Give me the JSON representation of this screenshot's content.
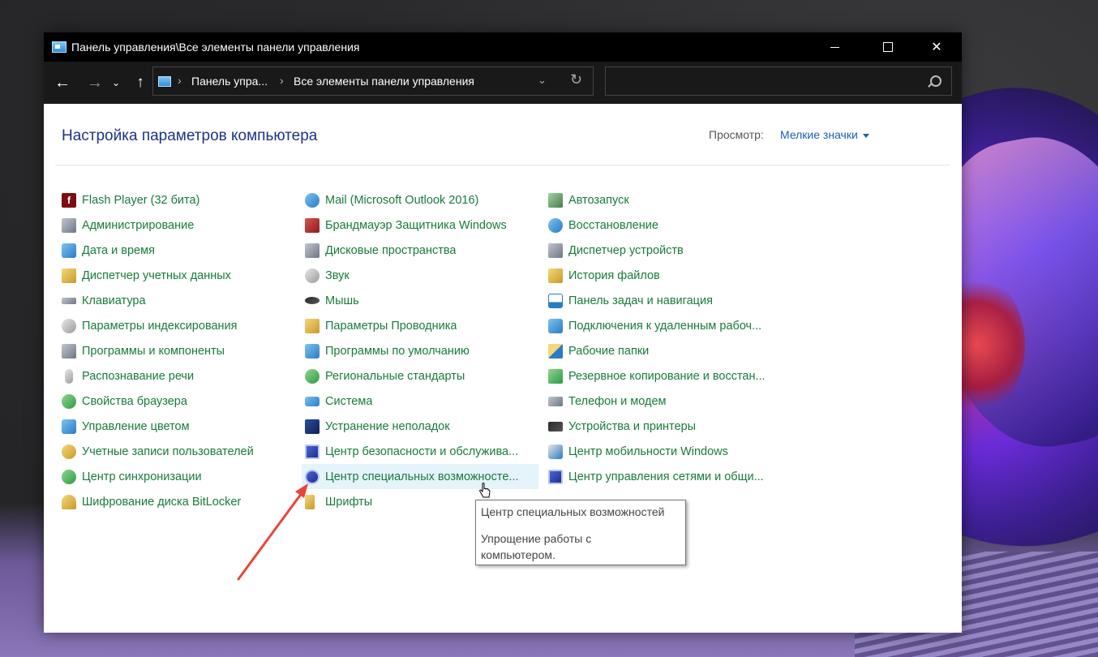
{
  "window": {
    "title": "Панель управления\\Все элементы панели управления",
    "controls": {
      "minimize": "minimize",
      "maximize": "maximize",
      "close": "close"
    }
  },
  "navigation": {
    "breadcrumbs": [
      "Панель упра...",
      "Все элементы панели управления"
    ],
    "search_placeholder": ""
  },
  "header": {
    "title": "Настройка параметров компьютера",
    "view_label": "Просмотр:",
    "view_value": "Мелкие значки"
  },
  "columns": [
    [
      {
        "label": "Flash Player (32 бита)",
        "icon": "flash-icon"
      },
      {
        "label": "Администрирование",
        "icon": "admin-tools-icon"
      },
      {
        "label": "Дата и время",
        "icon": "calendar-clock-icon"
      },
      {
        "label": "Диспетчер учетных данных",
        "icon": "credential-vault-icon"
      },
      {
        "label": "Клавиатура",
        "icon": "keyboard-icon"
      },
      {
        "label": "Параметры индексирования",
        "icon": "indexing-icon"
      },
      {
        "label": "Программы и компоненты",
        "icon": "programs-icon"
      },
      {
        "label": "Распознавание речи",
        "icon": "microphone-icon"
      },
      {
        "label": "Свойства браузера",
        "icon": "globe-icon"
      },
      {
        "label": "Управление цветом",
        "icon": "color-management-icon"
      },
      {
        "label": "Учетные записи пользователей",
        "icon": "users-icon"
      },
      {
        "label": "Центр синхронизации",
        "icon": "sync-icon"
      },
      {
        "label": "Шифрование диска BitLocker",
        "icon": "key-icon"
      }
    ],
    [
      {
        "label": "Mail (Microsoft Outlook 2016)",
        "icon": "mail-icon"
      },
      {
        "label": "Брандмауэр Защитника Windows",
        "icon": "firewall-icon"
      },
      {
        "label": "Дисковые пространства",
        "icon": "storage-spaces-icon"
      },
      {
        "label": "Звук",
        "icon": "speaker-icon"
      },
      {
        "label": "Мышь",
        "icon": "mouse-icon"
      },
      {
        "label": "Параметры Проводника",
        "icon": "folder-options-icon"
      },
      {
        "label": "Программы по умолчанию",
        "icon": "default-programs-icon"
      },
      {
        "label": "Региональные стандарты",
        "icon": "region-icon"
      },
      {
        "label": "Система",
        "icon": "system-icon"
      },
      {
        "label": "Устранение неполадок",
        "icon": "troubleshoot-icon"
      },
      {
        "label": "Центр безопасности и обслужива...",
        "icon": "flag-icon"
      },
      {
        "label": "Центр специальных возможносте...",
        "icon": "accessibility-icon"
      },
      {
        "label": "Шрифты",
        "icon": "fonts-icon"
      }
    ],
    [
      {
        "label": "Автозапуск",
        "icon": "autoplay-icon"
      },
      {
        "label": "Восстановление",
        "icon": "recovery-icon"
      },
      {
        "label": "Диспетчер устройств",
        "icon": "device-manager-icon"
      },
      {
        "label": "История файлов",
        "icon": "file-history-icon"
      },
      {
        "label": "Панель задач и навигация",
        "icon": "taskbar-icon"
      },
      {
        "label": "Подключения к удаленным рабоч...",
        "icon": "remote-desktop-icon"
      },
      {
        "label": "Рабочие папки",
        "icon": "work-folders-icon"
      },
      {
        "label": "Резервное копирование и восстан...",
        "icon": "backup-icon"
      },
      {
        "label": "Телефон и модем",
        "icon": "phone-modem-icon"
      },
      {
        "label": "Устройства и принтеры",
        "icon": "printer-icon"
      },
      {
        "label": "Центр мобильности Windows",
        "icon": "mobility-center-icon"
      },
      {
        "label": "Центр управления сетями и общи...",
        "icon": "network-icon"
      }
    ]
  ],
  "tooltip": {
    "title": "Центр специальных возможностей",
    "description": "Упрощение работы с компьютером."
  },
  "colors": {
    "link_green": "#197a3c",
    "title_blue": "#1e3287",
    "view_blue": "#1a5fb4",
    "hover_bg": "#e5f3fb",
    "annotation_arrow": "#e8453c"
  }
}
